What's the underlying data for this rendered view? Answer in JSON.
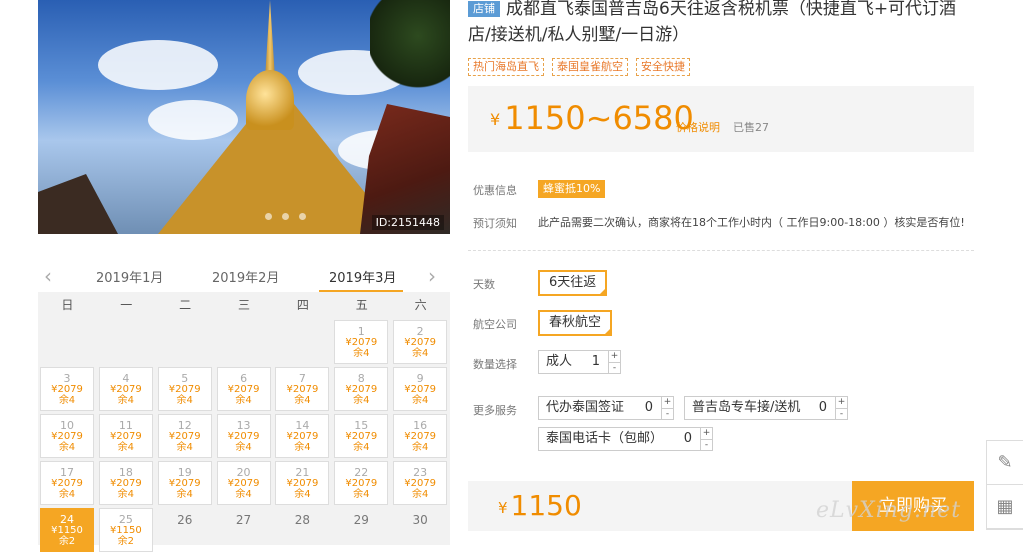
{
  "photo": {
    "id_label": "ID:2151448"
  },
  "title": {
    "badge": "店铺",
    "text": "成都直飞泰国普吉岛6天往返含税机票（快捷直飞+可代订酒店/接送机/私人别墅/一日游）"
  },
  "tags": [
    "热门海岛直飞",
    "泰国皇雀航空",
    "安全快捷"
  ],
  "price": {
    "currency": "¥",
    "range": "1150~6580",
    "explain_link": "价格说明",
    "sold": "已售27"
  },
  "promo": {
    "label": "优惠信息",
    "badge": "蜂蜜抵10%"
  },
  "notice": {
    "label": "预订须知",
    "text": "此产品需要二次确认，商家将在18个工作小时内（ 工作日9:00-18:00 ）核实是否有位!"
  },
  "options": {
    "days_label": "天数",
    "days_value": "6天往返",
    "airline_label": "航空公司",
    "airline_value": "春秋航空",
    "quantity_label": "数量选择",
    "quantity_name": "成人",
    "quantity_value": "1",
    "more_label": "更多服务",
    "services": [
      {
        "name": "代办泰国签证",
        "qty": "0"
      },
      {
        "name": "普吉岛专车接/送机",
        "qty": "0"
      },
      {
        "name": "泰国电话卡（包邮）",
        "qty": "0"
      }
    ],
    "plus": "+",
    "minus": "-"
  },
  "total": {
    "currency": "¥",
    "value": "1150",
    "buy_label": "立即购买"
  },
  "calendar": {
    "months": [
      "2019年1月",
      "2019年2月",
      "2019年3月"
    ],
    "prev_icon": "‹",
    "next_icon": "›",
    "weekdays": [
      "日",
      "一",
      "二",
      "三",
      "四",
      "五",
      "六"
    ],
    "cells": [
      {
        "d": "1",
        "p": "¥2079",
        "r": "余4"
      },
      {
        "d": "2",
        "p": "¥2079",
        "r": "余4"
      },
      {
        "d": "3",
        "p": "¥2079",
        "r": "余4"
      },
      {
        "d": "4",
        "p": "¥2079",
        "r": "余4"
      },
      {
        "d": "5",
        "p": "¥2079",
        "r": "余4"
      },
      {
        "d": "6",
        "p": "¥2079",
        "r": "余4"
      },
      {
        "d": "7",
        "p": "¥2079",
        "r": "余4"
      },
      {
        "d": "8",
        "p": "¥2079",
        "r": "余4"
      },
      {
        "d": "9",
        "p": "¥2079",
        "r": "余4"
      },
      {
        "d": "10",
        "p": "¥2079",
        "r": "余4"
      },
      {
        "d": "11",
        "p": "¥2079",
        "r": "余4"
      },
      {
        "d": "12",
        "p": "¥2079",
        "r": "余4"
      },
      {
        "d": "13",
        "p": "¥2079",
        "r": "余4"
      },
      {
        "d": "14",
        "p": "¥2079",
        "r": "余4"
      },
      {
        "d": "15",
        "p": "¥2079",
        "r": "余4"
      },
      {
        "d": "16",
        "p": "¥2079",
        "r": "余4"
      },
      {
        "d": "17",
        "p": "¥2079",
        "r": "余4"
      },
      {
        "d": "18",
        "p": "¥2079",
        "r": "余4"
      },
      {
        "d": "19",
        "p": "¥2079",
        "r": "余4"
      },
      {
        "d": "20",
        "p": "¥2079",
        "r": "余4"
      },
      {
        "d": "21",
        "p": "¥2079",
        "r": "余4"
      },
      {
        "d": "22",
        "p": "¥2079",
        "r": "余4"
      },
      {
        "d": "23",
        "p": "¥2079",
        "r": "余4"
      },
      {
        "d": "24",
        "p": "¥1150",
        "r": "余2"
      },
      {
        "d": "25",
        "p": "¥1150",
        "r": "余2"
      },
      {
        "d": "26"
      },
      {
        "d": "27"
      },
      {
        "d": "28"
      },
      {
        "d": "29"
      },
      {
        "d": "30"
      }
    ]
  },
  "watermark": "eLvXing.net",
  "side_tools": [
    "edit-icon",
    "qrcode-icon"
  ]
}
